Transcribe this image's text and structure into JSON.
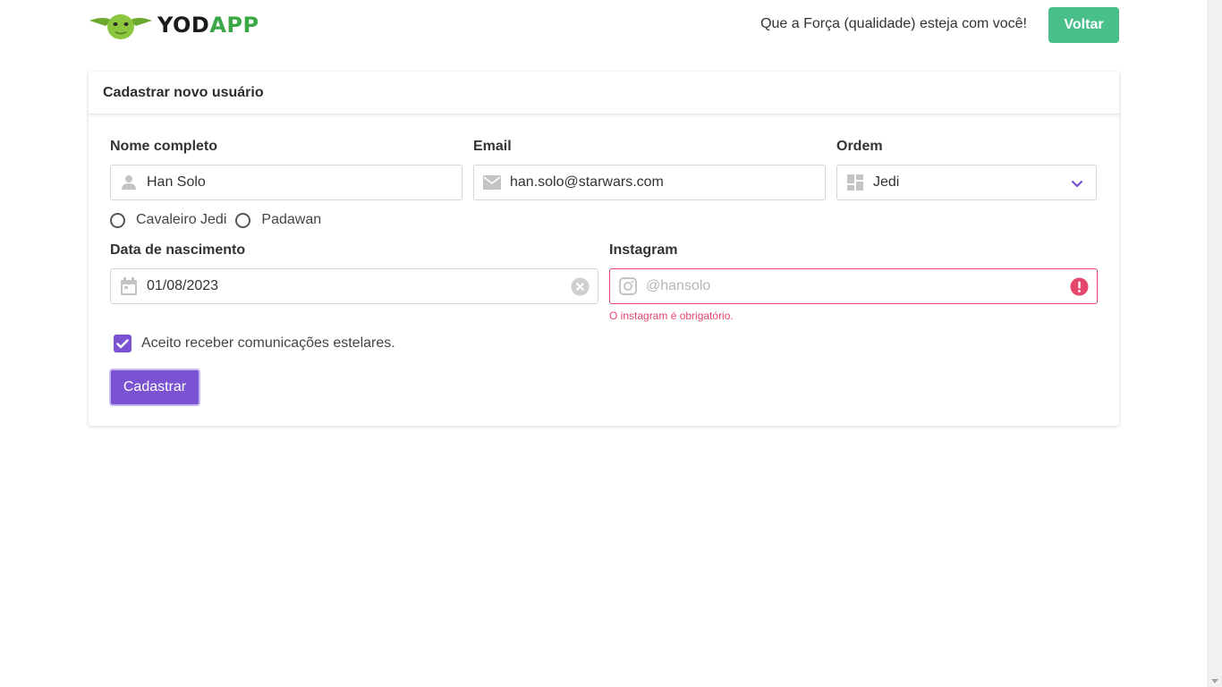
{
  "header": {
    "logo_text_main": "YOD",
    "logo_text_accent": "APP",
    "motto": "Que a Força (qualidade) esteja com você!",
    "back_label": "Voltar"
  },
  "form": {
    "title": "Cadastrar novo usuário",
    "name": {
      "label": "Nome completo",
      "value": "Han Solo"
    },
    "email": {
      "label": "Email",
      "value": "han.solo@starwars.com"
    },
    "order": {
      "label": "Ordem",
      "value": "Jedi"
    },
    "rank_options": [
      "Cavaleiro Jedi",
      "Padawan"
    ],
    "birth": {
      "label": "Data de nascimento",
      "value": "01/08/2023"
    },
    "instagram": {
      "label": "Instagram",
      "placeholder": "@hansolo",
      "error": "O instagram é obrigatório."
    },
    "consent_label": "Aceito receber comunicações estelares.",
    "consent_checked": true,
    "submit_label": "Cadastrar"
  },
  "colors": {
    "accent_purple": "#7b52d1",
    "back_green": "#49c08a",
    "error_red": "#e5476c",
    "logo_green": "#3aa844"
  }
}
